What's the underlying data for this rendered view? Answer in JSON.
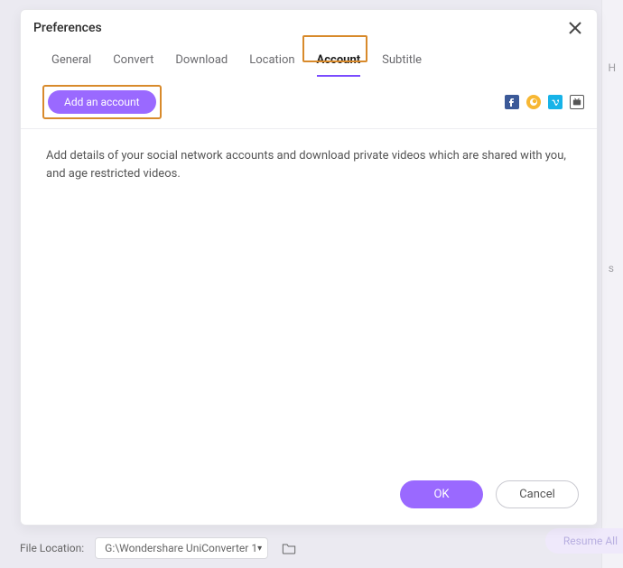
{
  "dialog": {
    "title": "Preferences",
    "tabs": {
      "general": "General",
      "convert": "Convert",
      "download": "Download",
      "location": "Location",
      "account": "Account",
      "subtitle": "Subtitle"
    },
    "add_account_label": "Add an account",
    "description": "Add details of your social network accounts and download private videos which are shared with you, and age restricted videos.",
    "ok_label": "OK",
    "cancel_label": "Cancel"
  },
  "social": {
    "facebook": "facebook",
    "crunchyroll": "crunchyroll",
    "vimeo": "vimeo",
    "niconico": "niconico"
  },
  "footer": {
    "file_location_label": "File Location:",
    "file_location_value": "G:\\Wondershare UniConverter 1",
    "resume_all_label": "Resume All"
  },
  "bg": {
    "h": "H",
    "s": "s"
  }
}
